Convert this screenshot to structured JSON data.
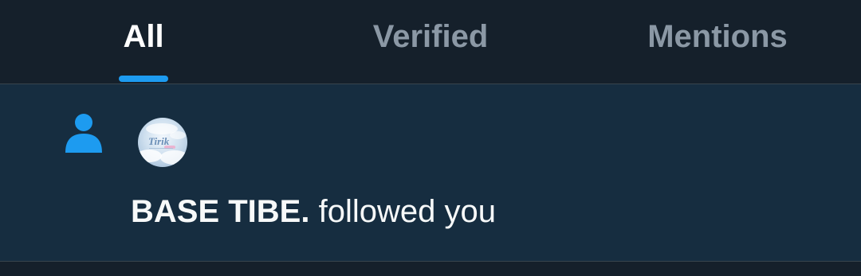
{
  "tabs": [
    {
      "label": "All",
      "active": true
    },
    {
      "label": "Verified",
      "active": false
    },
    {
      "label": "Mentions",
      "active": false
    }
  ],
  "notification": {
    "type_icon": "person-icon",
    "avatar_text": "Tirik",
    "user_name": "BASE TIBE.",
    "action": " followed you"
  },
  "colors": {
    "background": "#15202b",
    "notification_bg": "#162d40",
    "accent": "#1d9bf0",
    "text_primary": "#f7f9f9",
    "text_secondary": "#8b98a5",
    "divider": "#38444d"
  }
}
